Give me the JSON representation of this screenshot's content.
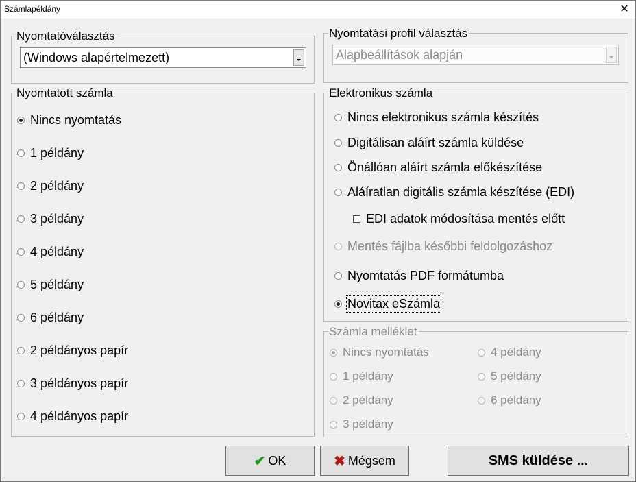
{
  "window": {
    "title": "Számlapéldány",
    "close_glyph": "✕"
  },
  "printer": {
    "legend": "Nyomtatóválasztás",
    "value": "(Windows alapértelmezett)"
  },
  "profile": {
    "legend": "Nyomtatási profil választás",
    "value": "Alapbeállítások alapján"
  },
  "printed": {
    "legend": "Nyomtatott számla",
    "options": [
      {
        "label": "Nincs nyomtatás",
        "selected": true
      },
      {
        "label": "1 példány",
        "selected": false
      },
      {
        "label": "2 példány",
        "selected": false
      },
      {
        "label": "3 példány",
        "selected": false
      },
      {
        "label": "4 példány",
        "selected": false
      },
      {
        "label": "5 példány",
        "selected": false
      },
      {
        "label": "6 példány",
        "selected": false
      },
      {
        "label": "2 példányos papír",
        "selected": false
      },
      {
        "label": "3 példányos papír",
        "selected": false
      },
      {
        "label": "4 példányos papír",
        "selected": false
      }
    ]
  },
  "electronic": {
    "legend": "Elektronikus számla",
    "options": [
      {
        "label": "Nincs elektronikus számla készítés",
        "selected": false,
        "enabled": true
      },
      {
        "label": "Digitálisan aláírt számla küldése",
        "selected": false,
        "enabled": true
      },
      {
        "label": "Önállóan aláírt számla előkészítése",
        "selected": false,
        "enabled": true
      },
      {
        "label": "Aláíratlan digitális számla készítése (EDI)",
        "selected": false,
        "enabled": true
      },
      {
        "label": "Mentés fájlba későbbi feldolgozáshoz",
        "selected": false,
        "enabled": false
      },
      {
        "label": "Nyomtatás PDF formátumba",
        "selected": false,
        "enabled": true
      },
      {
        "label": "Novitax eSzámla",
        "selected": true,
        "enabled": true
      }
    ],
    "edi_checkbox": {
      "label": "EDI adatok módosítása mentés előtt",
      "checked": false
    }
  },
  "attachment": {
    "legend": "Számla melléklet",
    "options": [
      {
        "label": "Nincs nyomtatás",
        "selected": true
      },
      {
        "label": "1 példány",
        "selected": false
      },
      {
        "label": "2 példány",
        "selected": false
      },
      {
        "label": "3 példány",
        "selected": false
      },
      {
        "label": "4 példány",
        "selected": false
      },
      {
        "label": "5 példány",
        "selected": false
      },
      {
        "label": "6 példány",
        "selected": false
      }
    ]
  },
  "buttons": {
    "ok": "OK",
    "ok_icon": "check-icon",
    "cancel": "Mégsem",
    "cancel_icon": "x-icon",
    "sms": "SMS küldése ..."
  },
  "colors": {
    "dialog_bg": "#f0f0f0",
    "disabled_text": "#8a8a8a",
    "ok_icon": "#1a9a1a",
    "cancel_icon": "#b01818"
  }
}
